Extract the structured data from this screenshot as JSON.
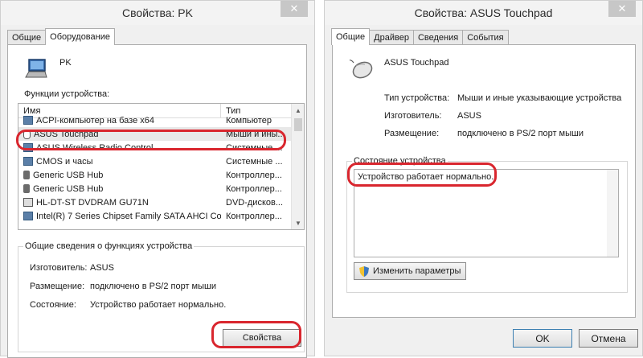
{
  "left_window": {
    "title": "Свойства: PK",
    "close_label": "✕",
    "tabs": [
      {
        "label": "Общие"
      },
      {
        "label": "Оборудование"
      }
    ],
    "pc_name": "PK",
    "functions_label": "Функции устройства:",
    "columns": {
      "name": "Имя",
      "type": "Тип"
    },
    "rows": [
      {
        "name": "ACPI-компьютер на базе x64",
        "type": "Компьютер"
      },
      {
        "name": "ASUS Touchpad",
        "type": "Мыши и ины..."
      },
      {
        "name": "ASUS Wireless Radio Control",
        "type": "Системные ..."
      },
      {
        "name": "CMOS и часы",
        "type": "Системные ..."
      },
      {
        "name": "Generic USB Hub",
        "type": "Контроллер..."
      },
      {
        "name": "Generic USB Hub",
        "type": "Контроллер..."
      },
      {
        "name": "HL-DT-ST DVDRAM GU71N",
        "type": "DVD-дисков..."
      },
      {
        "name": "Intel(R) 7 Series Chipset Family SATA AHCI Co...",
        "type": "Контроллер..."
      }
    ],
    "group_title": "Общие сведения о функциях устройства",
    "details": [
      {
        "k": "Изготовитель:",
        "v": "ASUS"
      },
      {
        "k": "Размещение:",
        "v": "подключено в PS/2 порт мыши"
      },
      {
        "k": "Состояние:",
        "v": "Устройство работает нормально."
      }
    ],
    "properties_button": "Свойства"
  },
  "right_window": {
    "title": "Свойства: ASUS Touchpad",
    "close_label": "✕",
    "tabs": [
      {
        "label": "Общие"
      },
      {
        "label": "Драйвер"
      },
      {
        "label": "Сведения"
      },
      {
        "label": "События"
      }
    ],
    "device_name": "ASUS Touchpad",
    "details": [
      {
        "k": "Тип устройства:",
        "v": "Мыши и иные указывающие устройства"
      },
      {
        "k": "Изготовитель:",
        "v": "ASUS"
      },
      {
        "k": "Размещение:",
        "v": "подключено в PS/2 порт мыши"
      }
    ],
    "status_group_title": "Состояние устройства",
    "status_text": "Устройство работает нормально.",
    "change_settings_button": "Изменить параметры",
    "ok_button": "OK",
    "cancel_button": "Отмена"
  },
  "colors": {
    "highlight": "#d9262e",
    "window_bg": "#f0f0f0"
  }
}
